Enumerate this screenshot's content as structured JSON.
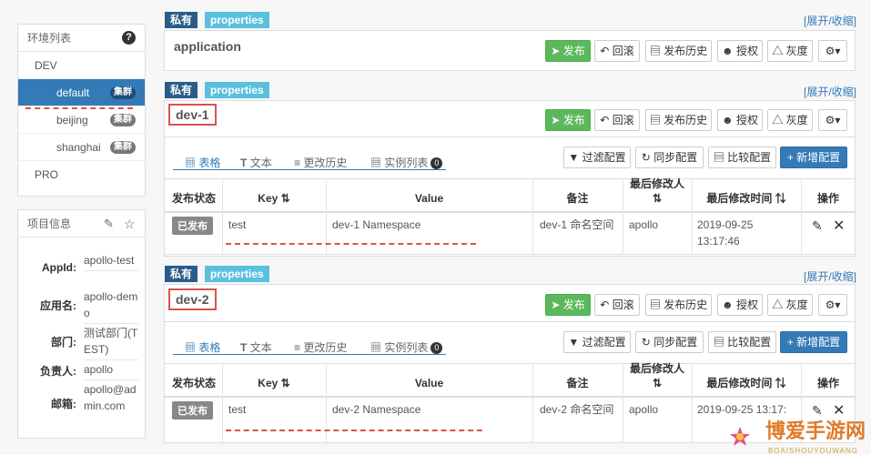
{
  "sidebar": {
    "env_list_title": "环境列表",
    "help_icon": "question-circle-icon",
    "envs": [
      {
        "label": "DEV",
        "type": "env"
      },
      {
        "label": "default",
        "type": "cluster",
        "badge": "集群",
        "active": true
      },
      {
        "label": "beijing",
        "type": "cluster",
        "badge": "集群"
      },
      {
        "label": "shanghai",
        "type": "cluster",
        "badge": "集群"
      },
      {
        "label": "PRO",
        "type": "env"
      }
    ],
    "project_info_title": "项目信息",
    "edit_icon": "edit-icon",
    "star_icon": "star-icon",
    "info": [
      {
        "label": "AppId:",
        "value": "apollo-test"
      },
      {
        "label": "应用名:",
        "value": "apollo-demo"
      },
      {
        "label": "部门:",
        "value": "测试部门(TEST)"
      },
      {
        "label": "负责人:",
        "value": "apollo"
      },
      {
        "label": "邮箱:",
        "value": "apollo@admin.com"
      }
    ]
  },
  "namespaces": [
    {
      "tag_private": "私有",
      "tag_type": "properties",
      "expand_label": "[展开/收缩]",
      "name": "application",
      "buttons": {
        "publish": "发布",
        "rollback": "回滚",
        "history": "发布历史",
        "grant": "授权",
        "gray": "灰度"
      }
    },
    {
      "tag_private": "私有",
      "tag_type": "properties",
      "expand_label": "[展开/收缩]",
      "name": "dev-1",
      "buttons": {
        "publish": "发布",
        "rollback": "回滚",
        "history": "发布历史",
        "grant": "授权",
        "gray": "灰度"
      },
      "tabs": {
        "table": "表格",
        "text": "文本",
        "history": "更改历史",
        "instances": "实例列表",
        "instance_count": "0"
      },
      "actions": {
        "filter": "过滤配置",
        "sync": "同步配置",
        "compare": "比较配置",
        "add": "+ 新增配置"
      },
      "columns": {
        "status": "发布状态",
        "key": "Key",
        "value": "Value",
        "comment": "备注",
        "modifier": "最后修改人",
        "modified_time": "最后修改时间",
        "ops": "操作"
      },
      "rows": [
        {
          "status": "已发布",
          "key": "test",
          "value": "dev-1 Namespace",
          "comment": "dev-1 命名空间",
          "modifier": "apollo",
          "time": "2019-09-25 13:17:46"
        }
      ]
    },
    {
      "tag_private": "私有",
      "tag_type": "properties",
      "expand_label": "[展开/收缩]",
      "name": "dev-2",
      "buttons": {
        "publish": "发布",
        "rollback": "回滚",
        "history": "发布历史",
        "grant": "授权",
        "gray": "灰度"
      },
      "tabs": {
        "table": "表格",
        "text": "文本",
        "history": "更改历史",
        "instances": "实例列表",
        "instance_count": "0"
      },
      "actions": {
        "filter": "过滤配置",
        "sync": "同步配置",
        "compare": "比较配置",
        "add": "+ 新增配置"
      },
      "columns": {
        "status": "发布状态",
        "key": "Key",
        "value": "Value",
        "comment": "备注",
        "modifier": "最后修改人",
        "modified_time": "最后修改时间",
        "ops": "操作"
      },
      "rows": [
        {
          "status": "已发布",
          "key": "test",
          "value": "dev-2 Namespace",
          "comment": "dev-2 命名空间",
          "modifier": "apollo",
          "time": "2019-09-25 13:17:"
        }
      ]
    }
  ],
  "watermark": {
    "title": "博爱手游网",
    "subtitle": "BOAISHOUYOUWANG"
  },
  "colors": {
    "primary": "#337ab7",
    "success": "#5cb85c",
    "info": "#5bc0de",
    "annotation": "#d9534f"
  }
}
